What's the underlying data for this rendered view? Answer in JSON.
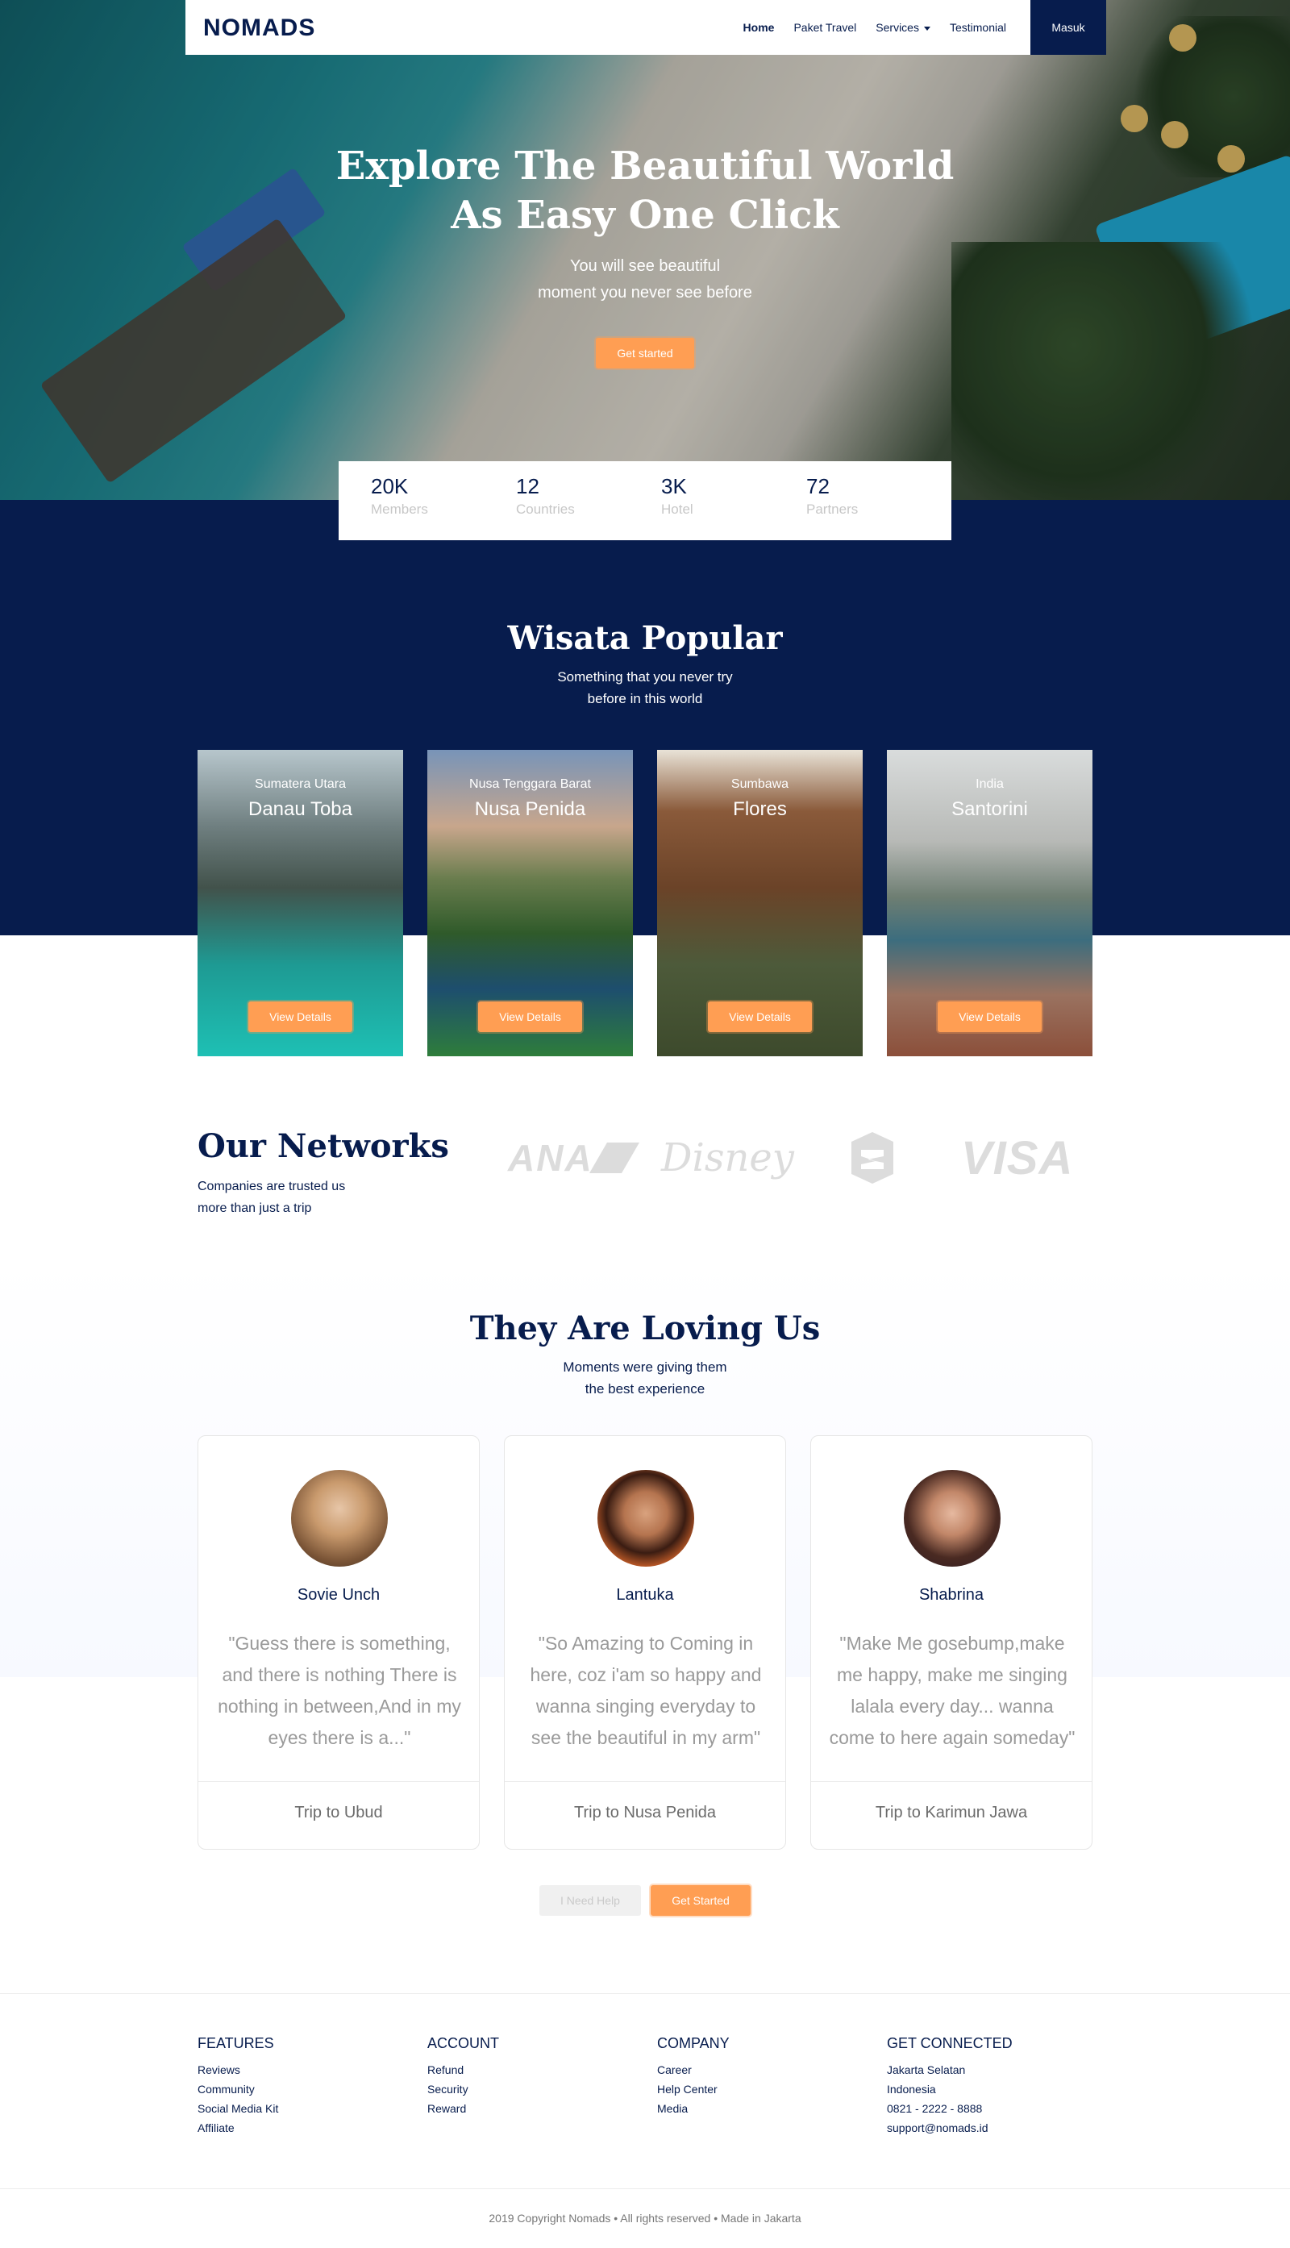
{
  "nav": {
    "logo": "NOMADS",
    "links": [
      "Home",
      "Paket Travel",
      "Services",
      "Testimonial"
    ],
    "login": "Masuk"
  },
  "hero": {
    "title_line1": "Explore The Beautiful World",
    "title_line2": "As Easy One Click",
    "subtitle_line1": "You will see beautiful",
    "subtitle_line2": "moment you never see before",
    "cta": "Get started"
  },
  "stats": [
    {
      "value": "20K",
      "label": "Members"
    },
    {
      "value": "12",
      "label": "Countries"
    },
    {
      "value": "3K",
      "label": "Hotel"
    },
    {
      "value": "72",
      "label": "Partners"
    }
  ],
  "popular": {
    "title": "Wisata Popular",
    "subtitle_line1": "Something that you never try",
    "subtitle_line2": "before in this world",
    "items": [
      {
        "province": "Sumatera Utara",
        "name": "Danau Toba",
        "button": "View Details"
      },
      {
        "province": "Nusa Tenggara Barat",
        "name": "Nusa Penida",
        "button": "View Details"
      },
      {
        "province": "Sumbawa",
        "name": "Flores",
        "button": "View Details"
      },
      {
        "province": "India",
        "name": "Santorini",
        "button": "View Details"
      }
    ]
  },
  "networks": {
    "title": "Our Networks",
    "subtitle_line1": "Companies are trusted us",
    "subtitle_line2": "more than just a trip",
    "logos": [
      "ANA",
      "Disney",
      "VISA"
    ]
  },
  "testimonials": {
    "title": "They Are Loving Us",
    "subtitle_line1": "Moments were giving them",
    "subtitle_line2": "the best experience",
    "items": [
      {
        "name": "Sovie Unch",
        "quote": "\"Guess there is something, and there is nothing There is nothing in between,And in my eyes there is a...\"",
        "trip": "Trip to Ubud"
      },
      {
        "name": "Lantuka",
        "quote": "\"So Amazing to Coming in here, coz i'am so happy and wanna singing everyday to see the beautiful in my arm\"",
        "trip": "Trip to Nusa Penida"
      },
      {
        "name": "Shabrina",
        "quote": "\"Make Me gosebump,make me happy, make me singing lalala every day... wanna come to here again someday\"",
        "trip": "Trip to Karimun Jawa"
      }
    ],
    "help_button": "I Need Help",
    "start_button": "Get Started"
  },
  "footer": {
    "columns": [
      {
        "heading": "FEATURES",
        "items": [
          "Reviews",
          "Community",
          "Social Media Kit",
          "Affiliate"
        ]
      },
      {
        "heading": "ACCOUNT",
        "items": [
          "Refund",
          "Security",
          "Reward"
        ]
      },
      {
        "heading": "COMPANY",
        "items": [
          "Career",
          "Help Center",
          "Media"
        ]
      },
      {
        "heading": "GET CONNECTED",
        "items": [
          "Jakarta Selatan",
          "Indonesia",
          "0821 - 2222 - 8888",
          "support@nomads.id"
        ]
      }
    ],
    "copyright": "2019 Copyright Nomads • All rights reserved • Made in Jakarta"
  },
  "colors": {
    "navy": "#071c4d",
    "orange": "#ff9e53"
  }
}
